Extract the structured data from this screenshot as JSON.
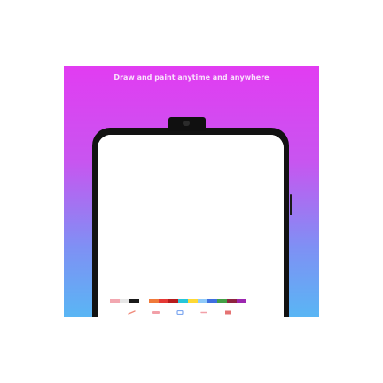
{
  "promo": {
    "headline": "Draw and paint anytime and anywhere"
  },
  "palette": [
    {
      "name": "pink",
      "color": "#f2a7b0"
    },
    {
      "name": "light-gray",
      "color": "#e6e6e6"
    },
    {
      "name": "black",
      "color": "#1a1a1a"
    },
    {
      "name": "white",
      "color": "#ffffff"
    },
    {
      "name": "orange",
      "color": "#f07a3a"
    },
    {
      "name": "red",
      "color": "#e53935"
    },
    {
      "name": "dark-red",
      "color": "#b71c1c"
    },
    {
      "name": "teal",
      "color": "#26c6da"
    },
    {
      "name": "yellow",
      "color": "#fdd835"
    },
    {
      "name": "light-blue",
      "color": "#90caf9"
    },
    {
      "name": "blue",
      "color": "#3f6fe0"
    },
    {
      "name": "green",
      "color": "#43a047"
    },
    {
      "name": "maroon",
      "color": "#8e2440"
    },
    {
      "name": "purple",
      "color": "#9c27b0"
    }
  ],
  "tools": [
    {
      "name": "brush-icon",
      "color": "#f08a7a"
    },
    {
      "name": "eraser-icon",
      "color": "#f2a0a8"
    },
    {
      "name": "shape-icon",
      "color": "#7fa8f0"
    },
    {
      "name": "undo-icon",
      "color": "#f2a0a8"
    },
    {
      "name": "trash-icon",
      "color": "#e57373"
    }
  ],
  "colors": {
    "gradient_top": "#e23cf2",
    "gradient_bottom": "#59b6f4",
    "phone_body": "#121212"
  }
}
